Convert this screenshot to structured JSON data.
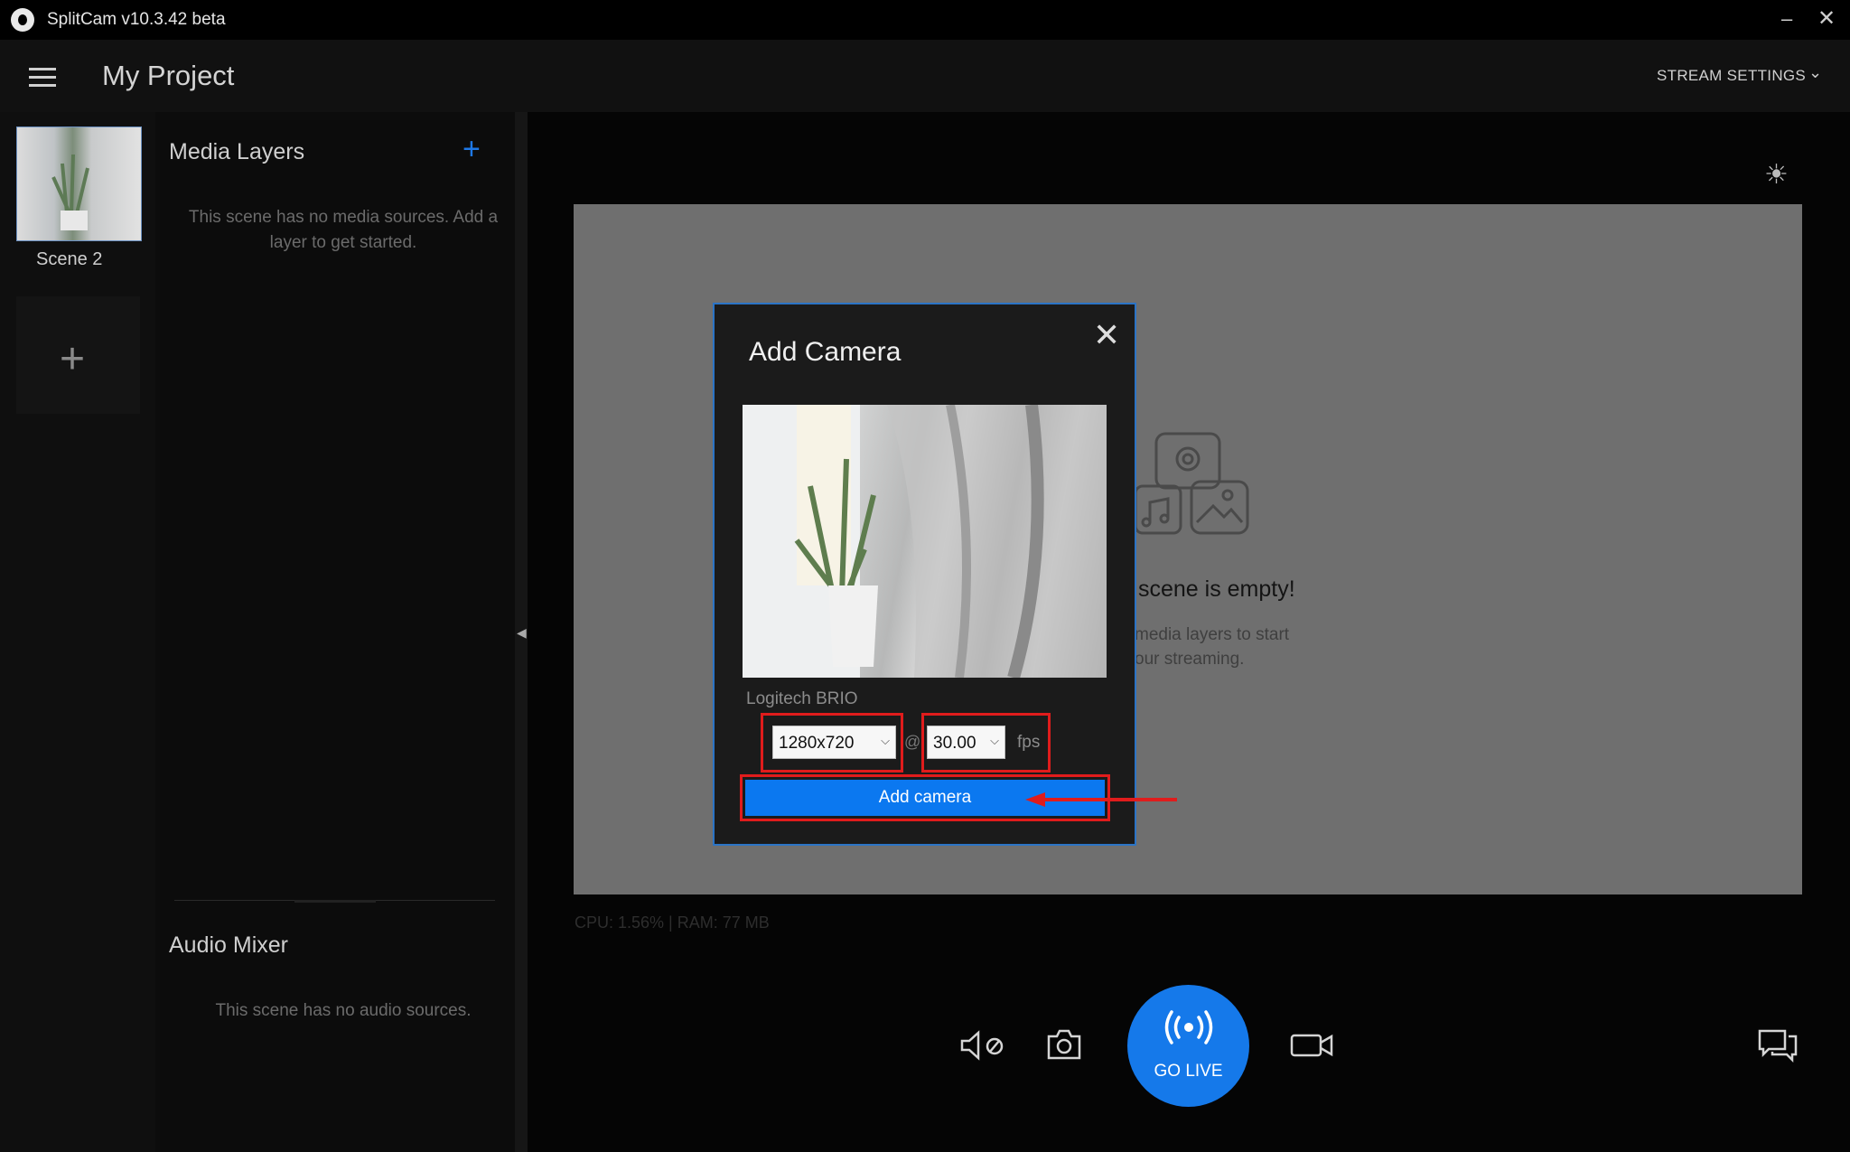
{
  "titlebar": {
    "title": "SplitCam v10.3.42 beta",
    "minimize": "–",
    "close": "✕"
  },
  "header": {
    "project_title": "My Project",
    "stream_settings": "STREAM SETTINGS",
    "chevron": "⌄"
  },
  "scenes": {
    "items": [
      {
        "label": "Scene 2"
      }
    ],
    "add_icon": "+"
  },
  "media_layers": {
    "title": "Media Layers",
    "add_icon": "+",
    "empty_text": "This scene has no media sources. Add a layer to get started."
  },
  "audio_mixer": {
    "title": "Audio Mixer",
    "empty_text": "This scene has no audio sources."
  },
  "preview": {
    "empty_title": "scene is empty!",
    "empty_desc_line1": "media layers to start",
    "empty_desc_line2": "our streaming.",
    "brightness_icon": "☀"
  },
  "status": {
    "text": "CPU: 1.56% | RAM: 77 MB"
  },
  "dialog": {
    "title": "Add Camera",
    "close_icon": "✕",
    "device_name": "Logitech BRIO",
    "resolution": "1280x720",
    "at_sign": "@",
    "fps_value": "30.00",
    "fps_unit": "fps",
    "add_button": "Add camera"
  },
  "controls": {
    "go_live": "GO LIVE"
  },
  "colors": {
    "accent": "#1579ea",
    "highlight": "#e01c1c",
    "dialog_border": "#2b74c6"
  },
  "icons": [
    "menu-icon",
    "chevron-down-icon",
    "plus-icon",
    "brightness-icon",
    "close-icon",
    "mic-mute-icon",
    "camera-snapshot-icon",
    "broadcast-icon",
    "video-camera-icon",
    "chat-icon"
  ]
}
